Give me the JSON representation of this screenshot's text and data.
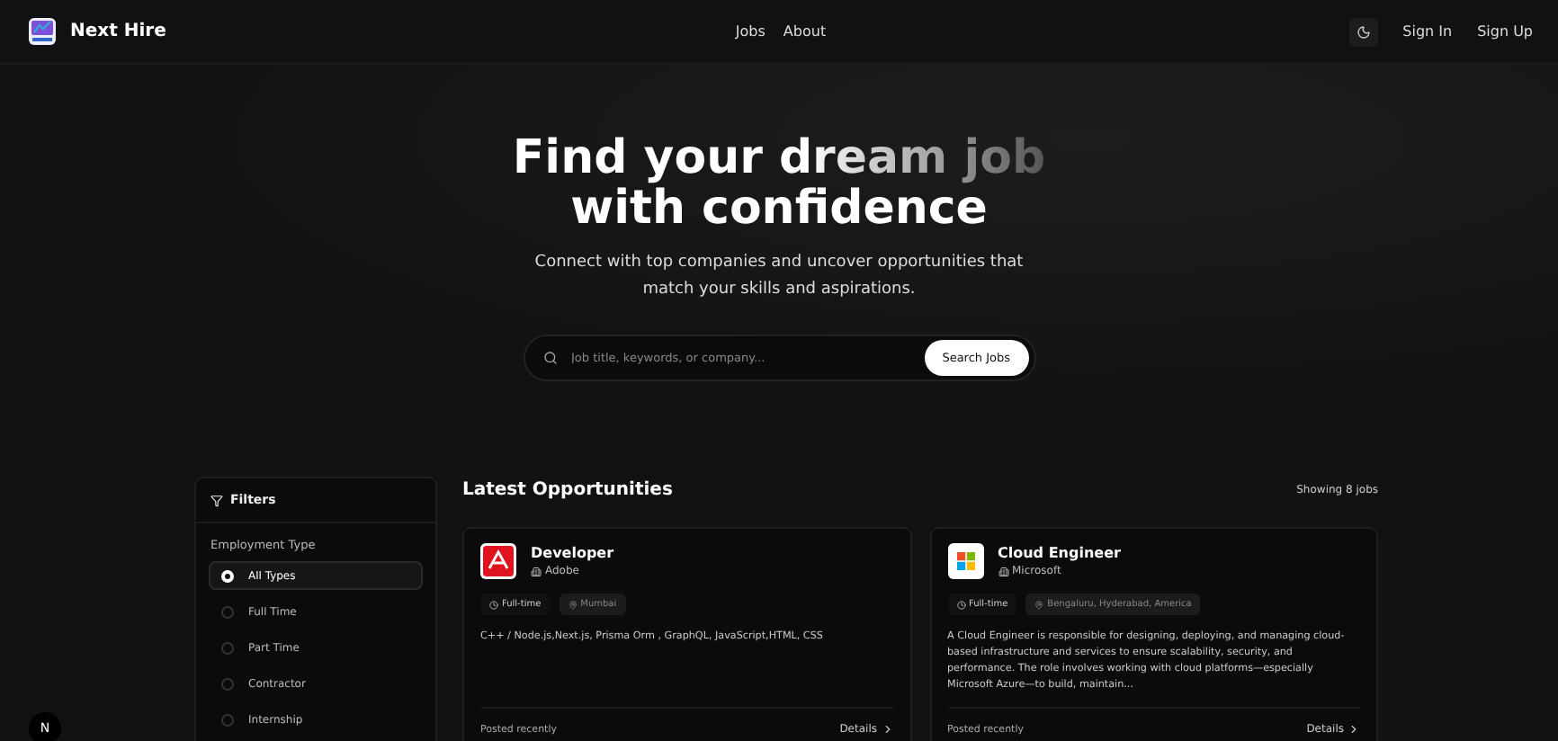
{
  "nav": {
    "brand": "Next Hire",
    "links": [
      "Jobs",
      "About"
    ],
    "sign_in": "Sign In",
    "sign_up": "Sign Up"
  },
  "hero": {
    "title_line1": "Find your dream job",
    "title_line2": "with confidence",
    "subtitle": "Connect with top companies and uncover opportunities that match your skills and aspirations.",
    "search": {
      "placeholder": "Job title, keywords, or company..."
    },
    "button": "Search Jobs"
  },
  "filters": {
    "title": "Filters",
    "group": "Employment Type",
    "options": [
      {
        "label": "All Types",
        "selected": true
      },
      {
        "label": "Full Time",
        "selected": false
      },
      {
        "label": "Part Time",
        "selected": false
      },
      {
        "label": "Contractor",
        "selected": false
      },
      {
        "label": "Internship",
        "selected": false
      }
    ]
  },
  "listing": {
    "title": "Latest Opportunities",
    "count": "Showing 8 jobs",
    "jobs": [
      {
        "title": "Developer",
        "company": "Adobe",
        "kind": "adobe",
        "type": "Full-time",
        "location": "Mumbai",
        "description": "C++ / Node.js,Next.js, Prisma Orm , GraphQL, JavaScript,HTML, CSS",
        "posted": "Posted recently",
        "details": "Details"
      },
      {
        "title": "Cloud Engineer",
        "company": "Microsoft",
        "kind": "microsoft",
        "type": "Full-time",
        "location": "Bengaluru, Hyderabad, America",
        "description": "A Cloud Engineer is responsible for designing, deploying, and managing cloud-based infrastructure and services to ensure scalability, security, and performance. The role involves working with cloud platforms—especially Microsoft Azure—to build, maintain...",
        "posted": "Posted recently",
        "details": "Details"
      }
    ]
  },
  "dev_badge": "N"
}
